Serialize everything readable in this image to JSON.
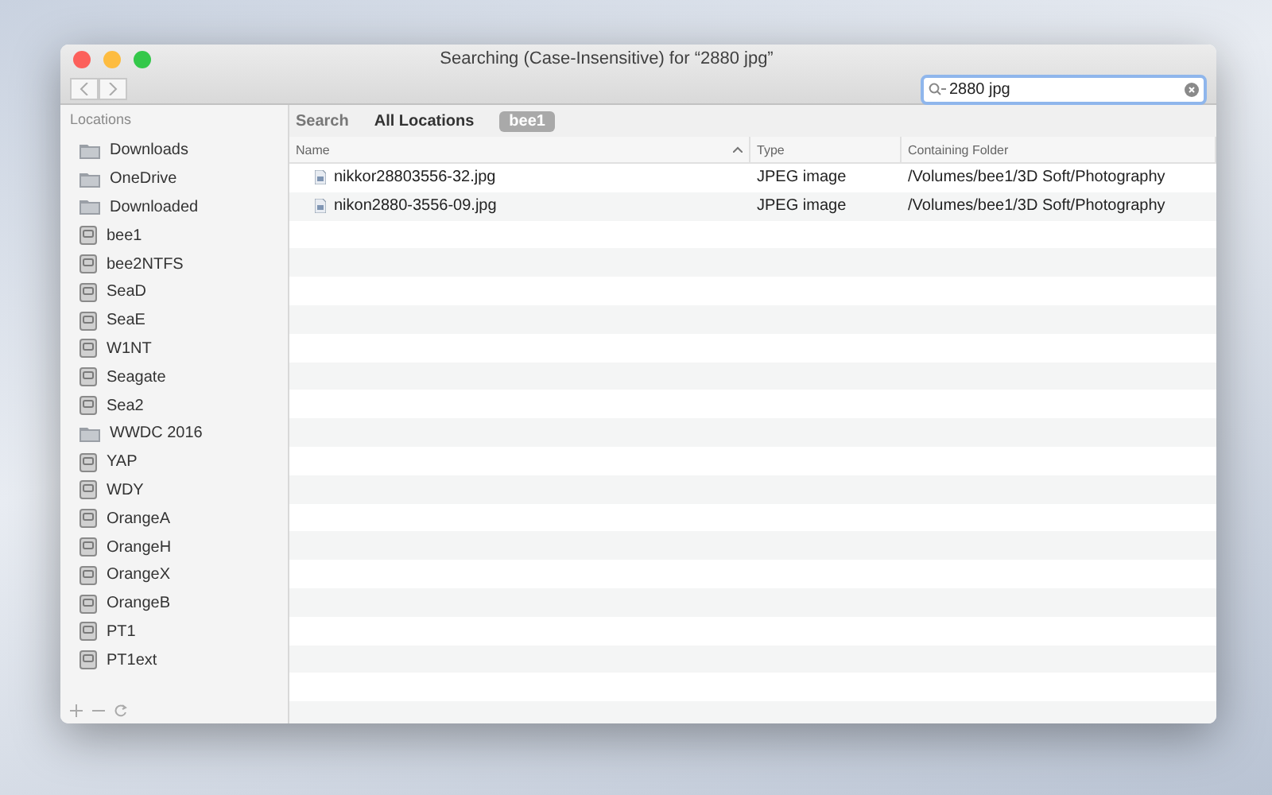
{
  "window": {
    "title": "Searching (Case-Insensitive) for “2880 jpg”"
  },
  "search": {
    "value": "2880 jpg"
  },
  "sidebar": {
    "heading": "Locations",
    "items": [
      {
        "label": "Downloads",
        "kind": "folder"
      },
      {
        "label": "OneDrive",
        "kind": "folder"
      },
      {
        "label": "Downloaded",
        "kind": "folder"
      },
      {
        "label": "bee1",
        "kind": "drive"
      },
      {
        "label": "bee2NTFS",
        "kind": "drive"
      },
      {
        "label": "SeaD",
        "kind": "drive"
      },
      {
        "label": "SeaE",
        "kind": "drive"
      },
      {
        "label": "W1NT",
        "kind": "drive"
      },
      {
        "label": "Seagate",
        "kind": "drive"
      },
      {
        "label": "Sea2",
        "kind": "drive"
      },
      {
        "label": "WWDC 2016",
        "kind": "folder"
      },
      {
        "label": "YAP",
        "kind": "drive"
      },
      {
        "label": "WDY",
        "kind": "drive"
      },
      {
        "label": "OrangeA",
        "kind": "drive"
      },
      {
        "label": "OrangeH",
        "kind": "drive"
      },
      {
        "label": "OrangeX",
        "kind": "drive"
      },
      {
        "label": "OrangeB",
        "kind": "drive"
      },
      {
        "label": "PT1",
        "kind": "drive"
      },
      {
        "label": "PT1ext",
        "kind": "drive"
      }
    ]
  },
  "scope_bar": {
    "label": "Search",
    "scopes": [
      {
        "label": "All Locations",
        "selected": false
      },
      {
        "label": "bee1",
        "selected": true
      }
    ]
  },
  "table": {
    "columns": [
      {
        "label": "Name",
        "sorted": true
      },
      {
        "label": "Type",
        "sorted": false
      },
      {
        "label": "Containing Folder",
        "sorted": false
      }
    ],
    "rows": [
      {
        "name": "nikkor28803556-32.jpg",
        "type": "JPEG image",
        "folder": "/Volumes/bee1/3D Soft/Photography"
      },
      {
        "name": "nikon2880-3556-09.jpg",
        "type": "JPEG image",
        "folder": "/Volumes/bee1/3D Soft/Photography"
      }
    ]
  }
}
